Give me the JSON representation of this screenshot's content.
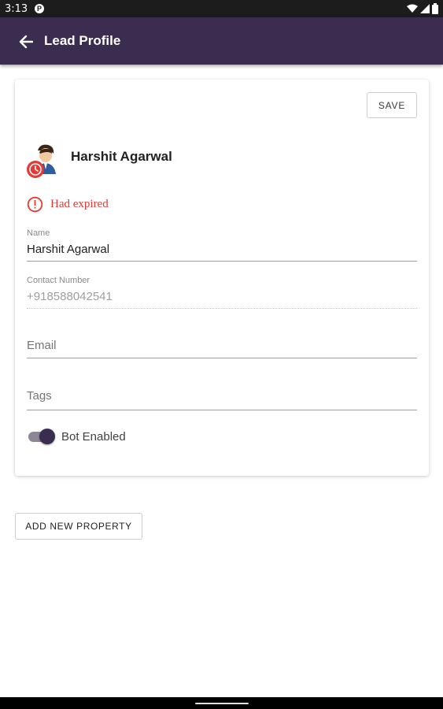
{
  "status_bar": {
    "time": "3:13",
    "app_icon": "P"
  },
  "icons": {
    "wifi": "wifi-icon",
    "signal": "signal-icon",
    "battery": "battery-icon",
    "back": "arrow-back-icon",
    "alert": "error-outline-icon",
    "clock": "clock-icon"
  },
  "app_bar": {
    "title": "Lead Profile"
  },
  "profile": {
    "save_label": "SAVE",
    "name": "Harshit Agarwal",
    "status_text": "Had expired"
  },
  "fields": {
    "name": {
      "label": "Name",
      "value": "Harshit Agarwal"
    },
    "contact": {
      "label": "Contact Number",
      "value": "+918588042541"
    },
    "email": {
      "placeholder": "Email"
    },
    "tags": {
      "placeholder": "Tags"
    }
  },
  "bot": {
    "label": "Bot Enabled",
    "enabled": true
  },
  "actions": {
    "add_property_label": "ADD NEW PROPERTY"
  },
  "colors": {
    "app_bar": "#3b2d4f",
    "error": "#e53935",
    "toggle_thumb": "#3b2d4f"
  }
}
